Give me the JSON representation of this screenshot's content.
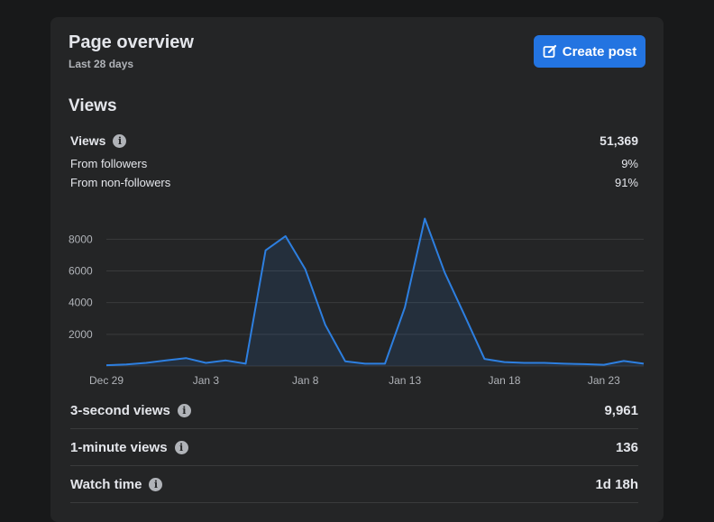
{
  "header": {
    "title": "Page overview",
    "subtitle": "Last 28 days",
    "create_post_label": "Create post"
  },
  "views_section": {
    "title": "Views",
    "total_label": "Views",
    "total_value": "51,369",
    "breakdown": [
      {
        "label": "From followers",
        "value": "9%"
      },
      {
        "label": "From non-followers",
        "value": "91%"
      }
    ]
  },
  "metrics": [
    {
      "label": "3-second views",
      "value": "9,961"
    },
    {
      "label": "1-minute views",
      "value": "136"
    },
    {
      "label": "Watch time",
      "value": "1d 18h"
    }
  ],
  "colors": {
    "accent": "#2374e1",
    "line": "#2d7fe0",
    "card": "#242526",
    "background": "#18191a"
  },
  "chart_data": {
    "type": "area",
    "x_tick_labels": [
      "Dec 29",
      "Jan 3",
      "Jan 8",
      "Jan 13",
      "Jan 18",
      "Jan 23"
    ],
    "y_tick_labels": [
      "8000",
      "6000",
      "4000",
      "2000"
    ],
    "ylim": [
      0,
      9500
    ],
    "grid": true,
    "series": [
      {
        "x": [
          "Dec 29",
          "Dec 30",
          "Dec 31",
          "Jan 1",
          "Jan 2",
          "Jan 3",
          "Jan 4",
          "Jan 5",
          "Jan 6",
          "Jan 7",
          "Jan 8",
          "Jan 9",
          "Jan 10",
          "Jan 11",
          "Jan 12",
          "Jan 13",
          "Jan 14",
          "Jan 15",
          "Jan 16",
          "Jan 17",
          "Jan 18",
          "Jan 19",
          "Jan 20",
          "Jan 21",
          "Jan 22",
          "Jan 23",
          "Jan 24",
          "Jan 25"
        ],
        "values": [
          50,
          100,
          200,
          350,
          500,
          200,
          350,
          150,
          7300,
          8200,
          6100,
          2600,
          300,
          150,
          150,
          3700,
          9300,
          5900,
          3200,
          450,
          250,
          200,
          200,
          150,
          120,
          80,
          320,
          150
        ]
      }
    ]
  }
}
